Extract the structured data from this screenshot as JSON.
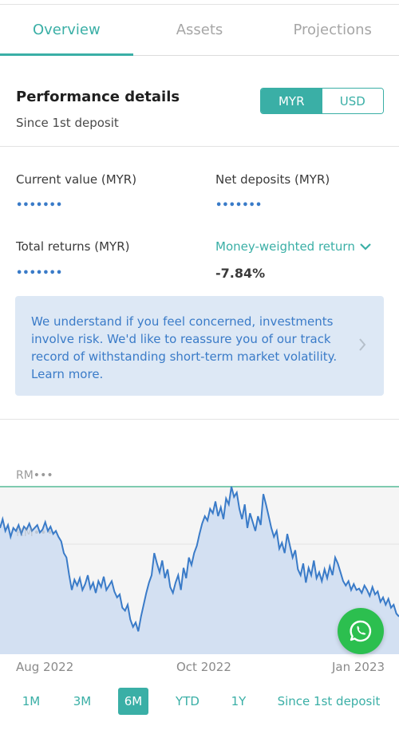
{
  "tabs": [
    {
      "label": "Overview",
      "active": true
    },
    {
      "label": "Assets",
      "active": false
    },
    {
      "label": "Projections",
      "active": false
    }
  ],
  "performance": {
    "title": "Performance details",
    "subtitle": "Since 1st deposit",
    "currency_options": [
      "MYR",
      "USD"
    ],
    "selected_currency": "MYR"
  },
  "metrics": {
    "current_value": {
      "label": "Current value (MYR)",
      "value": "•••••••"
    },
    "net_deposits": {
      "label": "Net deposits (MYR)",
      "value": "•••••••"
    },
    "total_returns": {
      "label": "Total returns (MYR)",
      "value": "•••••••"
    },
    "money_weighted": {
      "label": "Money-weighted return",
      "value": "-7.84%"
    }
  },
  "notice": {
    "text": "We understand if you feel concerned, investments involve risk. We'd like to reassure you of our track record of withstanding short-term market volatility. Learn more."
  },
  "chart": {
    "y_label_top": "RM•••",
    "y_label_mid": "RM•••",
    "x_labels": [
      "Aug 2022",
      "Oct 2022",
      "Jan 2023"
    ],
    "line_color": "#3a7bc8",
    "fill_color": "#d3e0f2",
    "top_line_color": "#7fcbb0"
  },
  "chart_data": {
    "type": "area",
    "title": "",
    "xlabel": "",
    "ylabel": "",
    "x": [
      "Aug 2022",
      "Oct 2022",
      "Jan 2023"
    ],
    "values": [
      0.72,
      0.78,
      0.7,
      0.74,
      0.66,
      0.72,
      0.7,
      0.74,
      0.68,
      0.73,
      0.71,
      0.75,
      0.7,
      0.72,
      0.74,
      0.69,
      0.71,
      0.76,
      0.7,
      0.73,
      0.68,
      0.7,
      0.66,
      0.63,
      0.55,
      0.52,
      0.4,
      0.3,
      0.37,
      0.33,
      0.38,
      0.3,
      0.34,
      0.4,
      0.31,
      0.35,
      0.28,
      0.36,
      0.32,
      0.39,
      0.3,
      0.33,
      0.36,
      0.29,
      0.25,
      0.27,
      0.18,
      0.16,
      0.2,
      0.1,
      0.05,
      0.08,
      0.02,
      0.12,
      0.2,
      0.28,
      0.35,
      0.4,
      0.55,
      0.48,
      0.42,
      0.5,
      0.38,
      0.44,
      0.32,
      0.28,
      0.35,
      0.4,
      0.3,
      0.45,
      0.38,
      0.52,
      0.47,
      0.55,
      0.6,
      0.68,
      0.75,
      0.8,
      0.77,
      0.85,
      0.82,
      0.9,
      0.8,
      0.86,
      0.78,
      0.92,
      0.88,
      1.0,
      0.93,
      0.96,
      0.85,
      0.78,
      0.88,
      0.72,
      0.82,
      0.76,
      0.7,
      0.8,
      0.74,
      0.95,
      0.88,
      0.8,
      0.72,
      0.66,
      0.7,
      0.58,
      0.62,
      0.55,
      0.68,
      0.6,
      0.52,
      0.57,
      0.44,
      0.4,
      0.48,
      0.35,
      0.45,
      0.4,
      0.5,
      0.38,
      0.42,
      0.36,
      0.44,
      0.38,
      0.46,
      0.4,
      0.52,
      0.48,
      0.42,
      0.36,
      0.33,
      0.36,
      0.3,
      0.34,
      0.3,
      0.31,
      0.28,
      0.33,
      0.3,
      0.26,
      0.32,
      0.27,
      0.29,
      0.22,
      0.25,
      0.2,
      0.24,
      0.18,
      0.2,
      0.14,
      0.12
    ],
    "grid": true
  },
  "ranges": {
    "options": [
      "1M",
      "3M",
      "6M",
      "YTD",
      "1Y",
      "Since 1st deposit"
    ],
    "selected": "6M"
  },
  "fab": {
    "icon": "whatsapp-icon"
  }
}
